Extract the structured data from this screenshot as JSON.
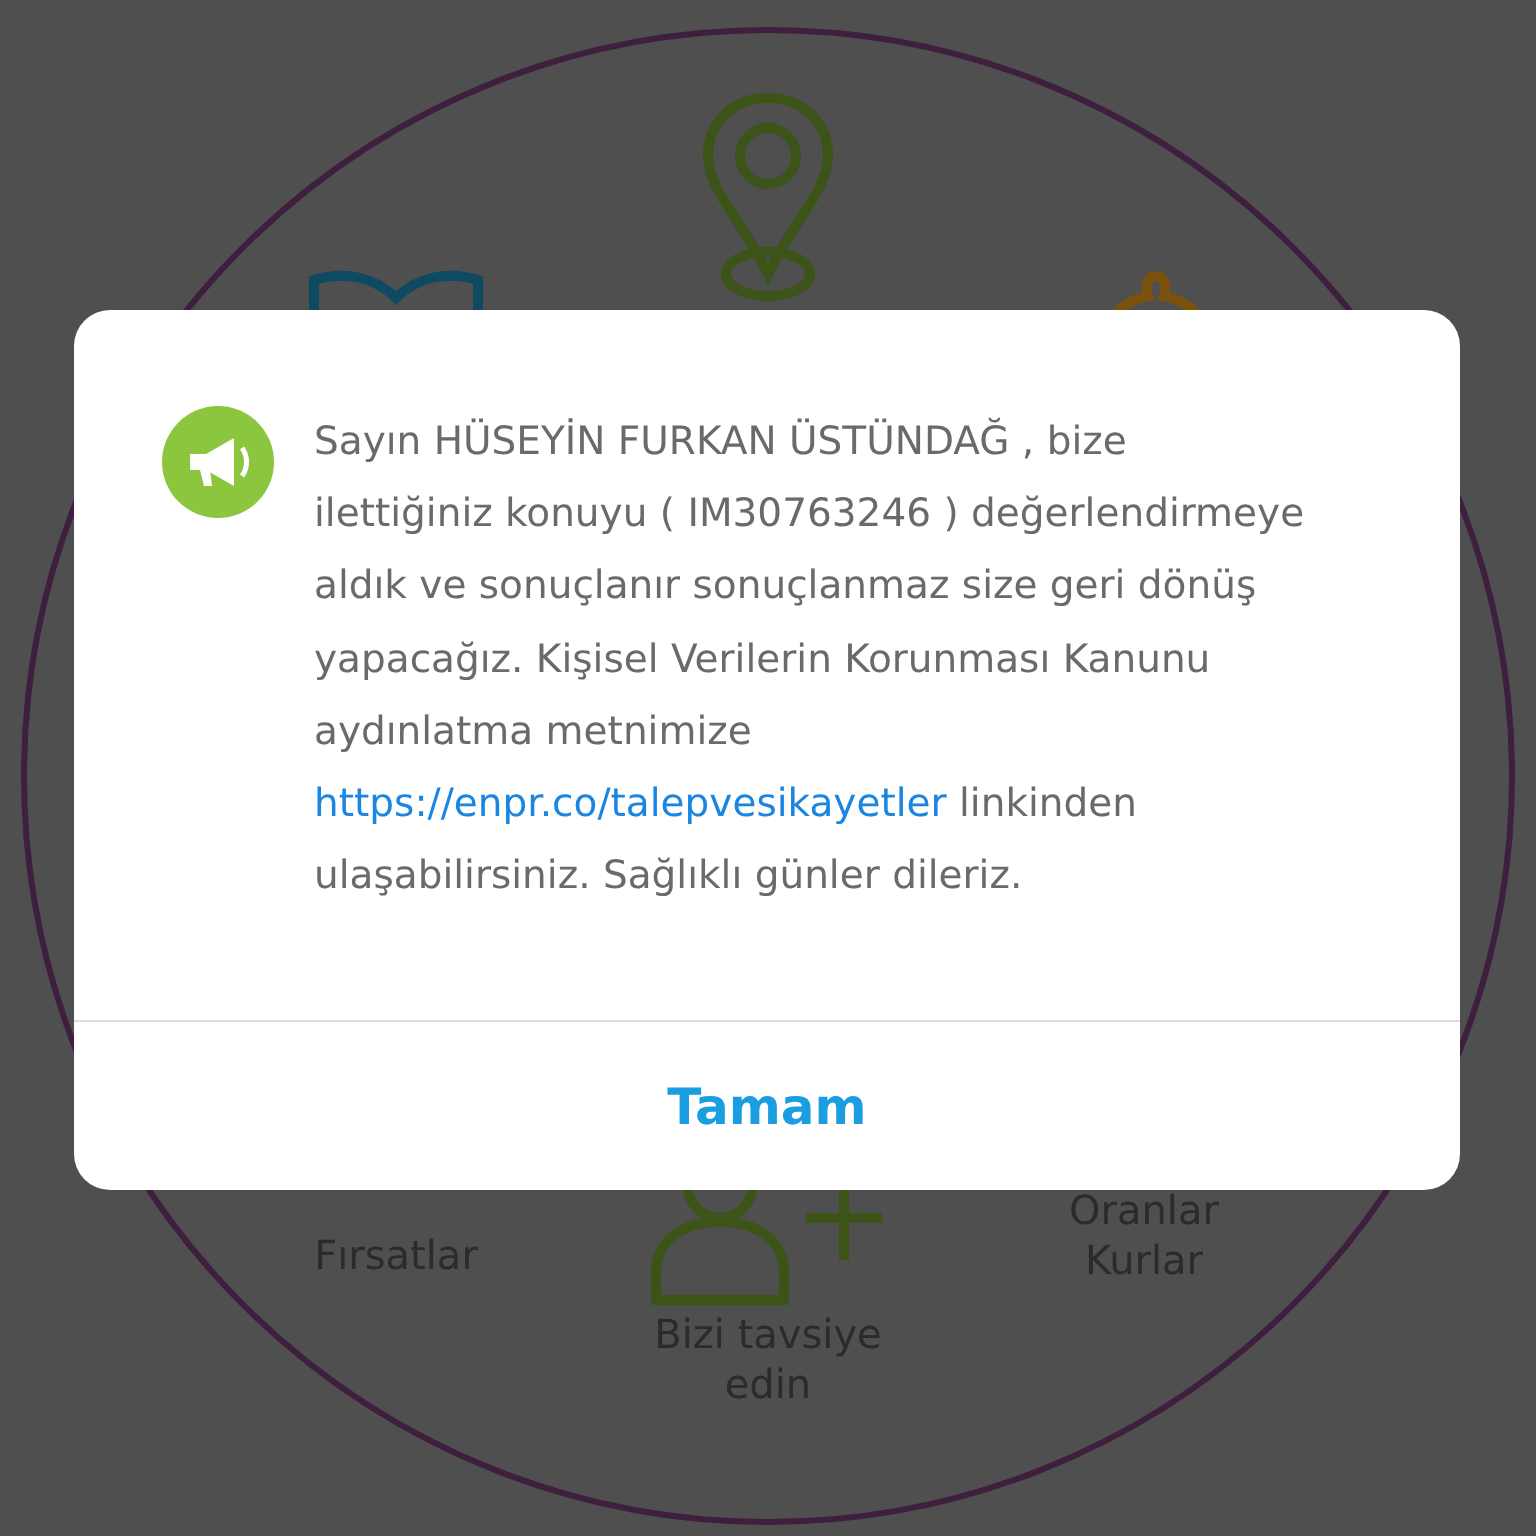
{
  "menu": {
    "items": [
      {
        "kind": "pin"
      },
      {
        "kind": "bow"
      },
      {
        "kind": "bag"
      },
      {
        "kind": "none",
        "label": "Fırsatlar"
      },
      {
        "kind": "add-person",
        "label": "Bizi tavsiye edin"
      },
      {
        "kind": "none",
        "label": "Oranlar Kurlar"
      }
    ]
  },
  "dialog": {
    "message_before": "Sayın  HÜSEYİN FURKAN ÜSTÜNDAĞ , bize ilettiğiniz konuyu ( IM30763246 ) değerlendirmeye aldık ve sonuçlanır sonuçlanmaz size geri dönüş yapacağız. Kişisel Verilerin Korunması Kanunu aydınlatma metnimize",
    "link": "https://enpr.co/talepvesikayetler",
    "message_after": "linkinden ulaşabilirsiniz. Sağlıklı günler dileriz.",
    "button": "Tamam"
  }
}
